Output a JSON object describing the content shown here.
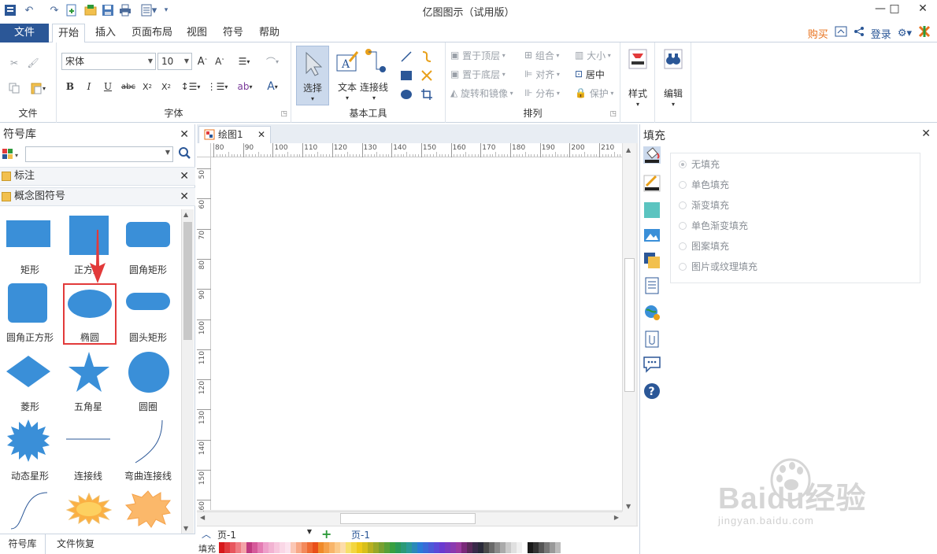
{
  "app": {
    "title": "亿图图示（试用版）",
    "window_buttons": [
      "—",
      "□",
      "✕"
    ]
  },
  "menu": {
    "file": "文件",
    "tabs": [
      "开始",
      "插入",
      "页面布局",
      "视图",
      "符号",
      "帮助"
    ],
    "buy": "购买",
    "login": "登录"
  },
  "ribbon": {
    "font_name": "宋体",
    "font_size": "10",
    "group_file": "文件",
    "group_font": "字体",
    "group_basic": "基本工具",
    "group_arrange": "排列",
    "select": "选择",
    "text": "文本",
    "connector": "连接线",
    "bring_top": "置于顶层",
    "send_bottom": "置于底层",
    "rotate_mirror": "旋转和镜像",
    "group_cmd": "组合",
    "align": "对齐",
    "distribute": "分布",
    "size": "大小",
    "center": "居中",
    "protect": "保护",
    "style": "样式",
    "edit": "编辑"
  },
  "library": {
    "title": "符号库",
    "categories": [
      "标注",
      "概念图符号"
    ],
    "shapes": [
      {
        "label": "矩形",
        "kind": "rect"
      },
      {
        "label": "正方形",
        "kind": "square"
      },
      {
        "label": "圆角矩形",
        "kind": "roundrect"
      },
      {
        "label": "圆角正方形",
        "kind": "roundsquare"
      },
      {
        "label": "椭圆",
        "kind": "ellipse"
      },
      {
        "label": "圆头矩形",
        "kind": "pill"
      },
      {
        "label": "菱形",
        "kind": "diamond"
      },
      {
        "label": "五角星",
        "kind": "star"
      },
      {
        "label": "圆圈",
        "kind": "circle"
      },
      {
        "label": "动态星形",
        "kind": "burst"
      },
      {
        "label": "连接线",
        "kind": "line"
      },
      {
        "label": "弯曲连接线",
        "kind": "curve"
      }
    ],
    "bottom_tabs": [
      "符号库",
      "文件恢复"
    ]
  },
  "document": {
    "tab": "绘图1",
    "hruler_ticks": [
      "80",
      "90",
      "100",
      "110",
      "120",
      "130",
      "140",
      "150",
      "160",
      "170",
      "180",
      "190",
      "200",
      "210"
    ],
    "vruler_ticks": [
      "50",
      "60",
      "70",
      "80",
      "90",
      "100",
      "110",
      "120",
      "130",
      "140",
      "150",
      "160"
    ],
    "page_select": "页-1",
    "page_tab": "页-1",
    "fill_label": "填充"
  },
  "fill_panel": {
    "title": "填充",
    "options": [
      "无填充",
      "单色填充",
      "渐变填充",
      "单色渐变填充",
      "图案填充",
      "图片或纹理填充"
    ],
    "selected": 0
  },
  "watermark": {
    "logo": "Baidu经验",
    "url": "jingyan.baidu.com"
  },
  "colors": {
    "shape_blue": "#3a8fd8",
    "accent_red": "#e23a3a",
    "file_tab": "#2b5797",
    "buy_orange": "#e8701a"
  }
}
